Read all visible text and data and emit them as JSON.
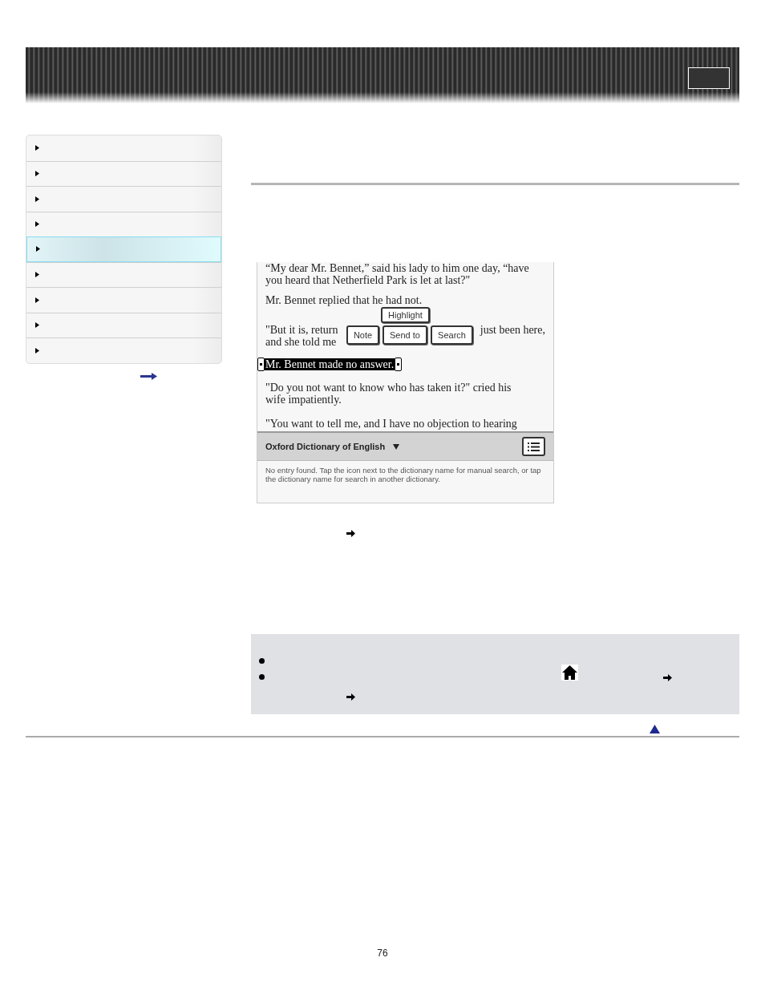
{
  "sidebar": {
    "items": [
      {
        "selected": false
      },
      {
        "selected": false
      },
      {
        "selected": false
      },
      {
        "selected": false
      },
      {
        "selected": true
      },
      {
        "selected": false
      },
      {
        "selected": false
      },
      {
        "selected": false
      },
      {
        "selected": false
      }
    ]
  },
  "book_screenshot": {
    "paragraphs": [
      {
        "selected": false,
        "lines": [
          [
            "“My dear Mr. Bennet,” said his lady to him one day, “have"
          ],
          [
            "you heard that Netherfield Park is let at last?\""
          ]
        ]
      },
      {
        "selected": false,
        "lines": [
          [
            "Mr. Bennet replied that he had not."
          ]
        ]
      },
      {
        "selected": false,
        "lines": [
          [
            "\"But it is, return",
            "just been here,"
          ],
          [
            "and she told me"
          ]
        ]
      },
      {
        "selected": true,
        "lines": [
          [
            "Mr. Bennet made no answer."
          ]
        ]
      },
      {
        "selected": false,
        "lines": [
          [
            "\"Do you not want to know who has taken it?\" cried his"
          ],
          [
            "wife impatiently."
          ]
        ]
      },
      {
        "selected": false,
        "lines": [
          [
            "\"You want to tell me, and I have no objection to hearing"
          ]
        ]
      }
    ],
    "popup": {
      "top_button": "Highlight",
      "buttons": [
        "Note",
        "Send to",
        "Search"
      ]
    },
    "dictionary": {
      "name": "Oxford Dictionary of English",
      "message": "No entry found. Tap the icon next to the dictionary name for manual search, or tap the dictionary name for search in another dictionary."
    }
  },
  "notes": {
    "bullets": [
      {
        "kind": "plain"
      },
      {
        "kind": "home"
      }
    ]
  },
  "footer": {
    "page_number": "76"
  }
}
